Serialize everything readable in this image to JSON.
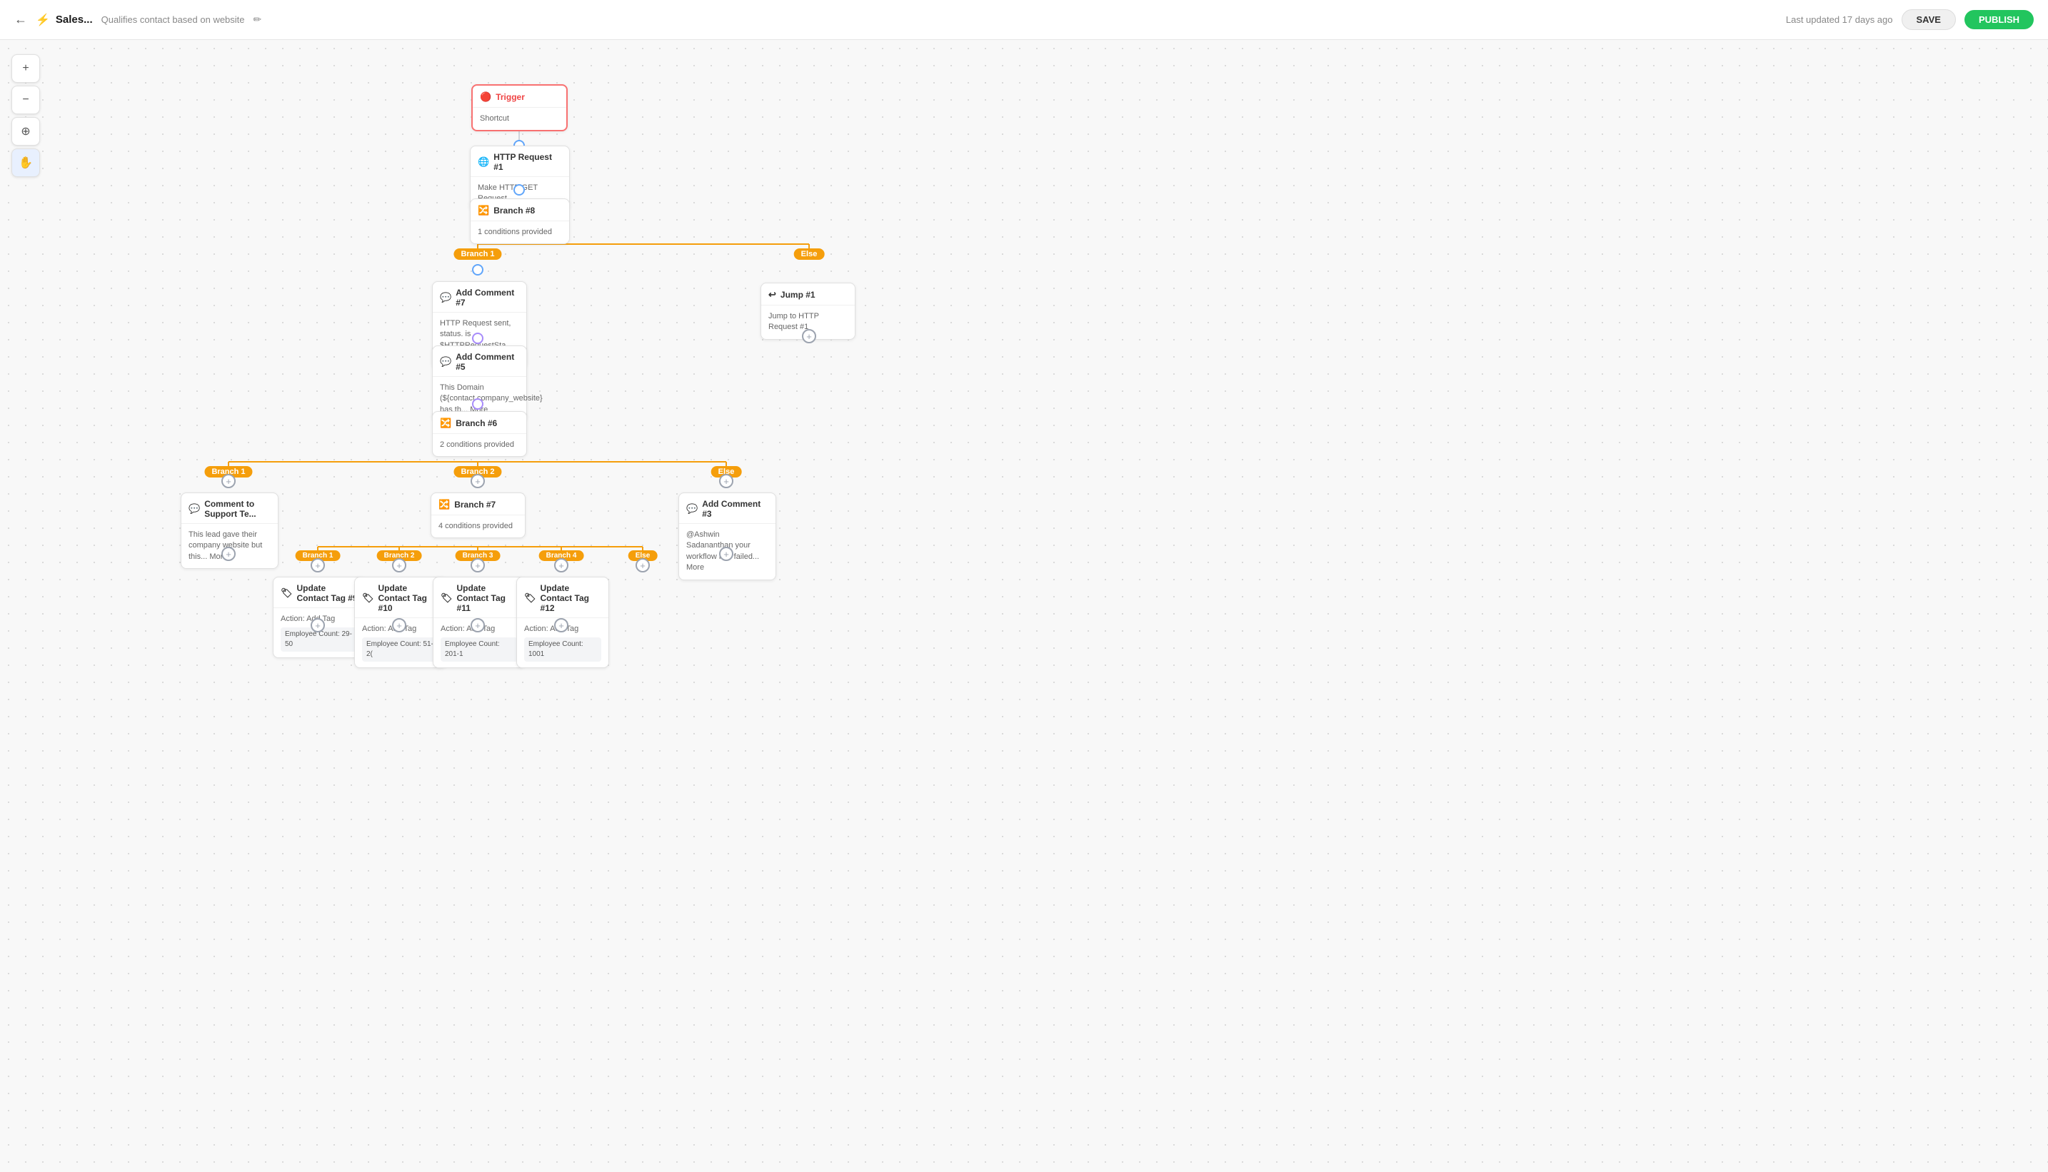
{
  "header": {
    "back_label": "←",
    "workflow_icon": "⚡",
    "workflow_title": "Sales...",
    "workflow_desc": "Qualifies contact based on website",
    "edit_icon": "✏",
    "last_updated": "Last updated 17 days ago",
    "save_label": "SAVE",
    "publish_label": "PUBLISH"
  },
  "toolbar": {
    "zoom_in": "+",
    "zoom_out": "−",
    "fit": "⊕",
    "hand": "✋"
  },
  "nodes": {
    "trigger": {
      "title": "Trigger",
      "body": "Shortcut",
      "icon": "🔴"
    },
    "http1": {
      "title": "HTTP Request #1",
      "body": "Make HTTP GET Request",
      "icon": "🌐"
    },
    "branch8": {
      "title": "Branch #8",
      "body": "1 conditions provided",
      "icon": "🔀"
    },
    "branch1_badge": "Branch 1",
    "else_badge1": "Else",
    "comment7": {
      "title": "Add Comment #7",
      "body": "HTTP Request sent, status. is $HTTPRequestSta... More",
      "icon": "💬"
    },
    "jump1": {
      "title": "Jump #1",
      "body": "Jump to HTTP Request #1",
      "icon": "↩"
    },
    "comment5": {
      "title": "Add Comment #5",
      "body": "This Domain (${contact.company_website} has th... More",
      "icon": "💬"
    },
    "branch6": {
      "title": "Branch #6",
      "body": "2 conditions provided",
      "icon": "🔀"
    },
    "branch1_badge2": "Branch 1",
    "branch2_badge": "Branch 2",
    "else_badge2": "Else",
    "comment_support": {
      "title": "Comment to Support Te...",
      "body": "This lead gave their company website but this... More",
      "icon": "💬"
    },
    "branch7": {
      "title": "Branch #7",
      "body": "4 conditions provided",
      "icon": "🔀"
    },
    "comment3": {
      "title": "Add Comment #3",
      "body": "@Ashwin Sadananthan your workflow has failed... More",
      "icon": "💬"
    },
    "branch1_badge3": "Branch 1",
    "branch2_badge3": "Branch 2",
    "branch3_badge3": "Branch 3",
    "branch4_badge3": "Branch 4",
    "else_badge3": "Else",
    "tag9": {
      "title": "Update Contact Tag #9",
      "body": "Action: Add Tag",
      "tag": "Employee Count: 29-50",
      "icon": "🏷"
    },
    "tag10": {
      "title": "Update Contact Tag #10",
      "body": "Action: Add Tag",
      "tag": "Employee Count: 51-2(",
      "icon": "🏷"
    },
    "tag11": {
      "title": "Update Contact Tag #11",
      "body": "Action: Add Tag",
      "tag": "Employee Count: 201-1",
      "icon": "🏷"
    },
    "tag12": {
      "title": "Update Contact Tag #12",
      "body": "Action: Add Tag",
      "tag": "Employee Count: 1001",
      "icon": "🏷"
    },
    "branch_main": "Branch",
    "branch1_main": "Branch 1",
    "branch2_main": "Branch 2",
    "branch3_main": "Branch 3",
    "branch4_extra": "Branch 4"
  }
}
